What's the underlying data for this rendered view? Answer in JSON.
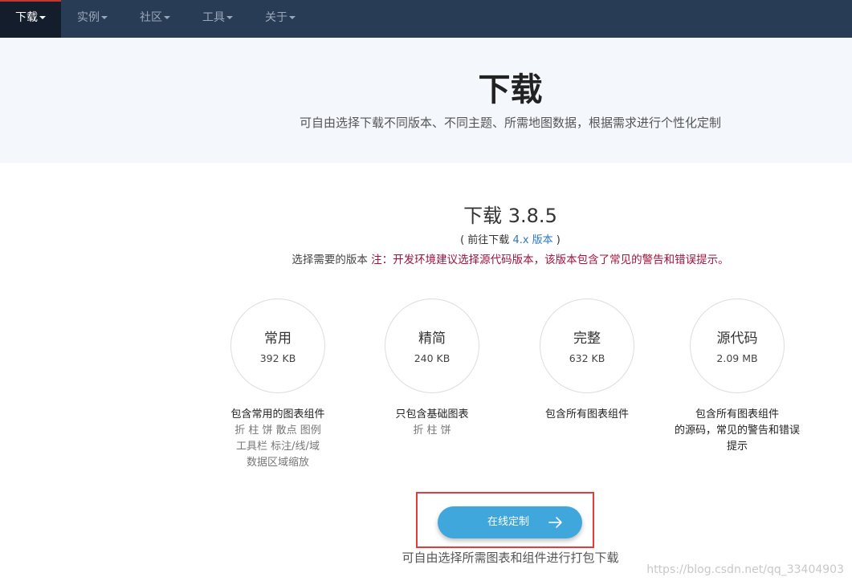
{
  "nav": {
    "items": [
      {
        "label": "下载",
        "active": true
      },
      {
        "label": "实例",
        "active": false
      },
      {
        "label": "社区",
        "active": false
      },
      {
        "label": "工具",
        "active": false
      },
      {
        "label": "关于",
        "active": false
      }
    ]
  },
  "hero": {
    "title": "下载",
    "subtitle": "可自由选择下载不同版本、不同主题、所需地图数据，根据需求进行个性化定制"
  },
  "version": {
    "title": "下载 3.8.5",
    "link_prefix": "( 前往下载 ",
    "link_text": "4.x 版本",
    "link_suffix": " )",
    "note_prefix": "选择需要的版本 ",
    "note_warning": "注：开发环境建议选择源代码版本，该版本包含了常见的警告和错误提示。"
  },
  "packages": [
    {
      "name": "常用",
      "size": "392 KB",
      "desc": "包含常用的图表组件",
      "features": [
        "折 柱 饼 散点 图例",
        "工具栏 标注/线/域",
        "数据区域缩放"
      ]
    },
    {
      "name": "精简",
      "size": "240 KB",
      "desc": "只包含基础图表",
      "features": [
        "折 柱 饼"
      ]
    },
    {
      "name": "完整",
      "size": "632 KB",
      "desc": "包含所有图表组件",
      "features": []
    },
    {
      "name": "源代码",
      "size": "2.09 MB",
      "desc": "包含所有图表组件",
      "features": [
        "的源码，常见的警告和错误",
        "提示"
      ]
    }
  ],
  "custom": {
    "button_label": "在线定制",
    "subtitle": "可自由选择所需图表和组件进行打包下载"
  },
  "watermark": "https://blog.csdn.net/qq_33404903",
  "colors": {
    "nav_bg": "#293c55",
    "accent": "#c23531",
    "button": "#3fa7dc",
    "warning": "#a0113a",
    "link": "#2b79c2"
  }
}
